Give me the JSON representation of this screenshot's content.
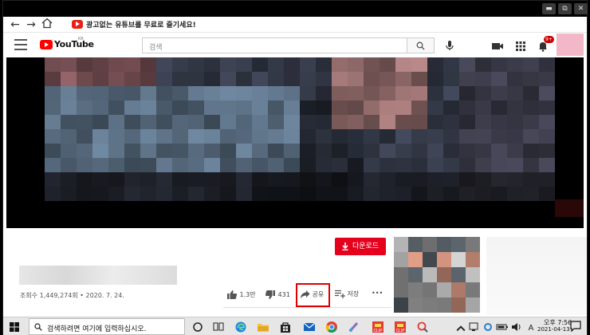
{
  "window": {
    "min": "▬",
    "restore": "⧉",
    "close": "✕"
  },
  "nav": {
    "extension_text": "광고없는 유튜브를 무료로 즐기세요!"
  },
  "header": {
    "logo_text": "YouTube",
    "logo_region": "KR",
    "search_placeholder": "검색",
    "notification_count": "9+"
  },
  "video": {
    "download_label": "다운로드",
    "views_text": "조회수 1,449,274회 • 2020. 7. 24.",
    "like_count": "1.3만",
    "dislike_count": "431",
    "share_label": "공유",
    "save_label": "저장",
    "more_label": "•••"
  },
  "taskbar": {
    "search_text": "검색하려면 여기에 입력하십시오.",
    "time": "오후 7:56",
    "date": "2021-04-13"
  },
  "colors": {
    "yt_red": "#ff0000",
    "download_red": "#e5001d",
    "highlight_red": "#e00000",
    "avatar_pink": "#f2b8c8"
  },
  "icons": [
    "back-icon",
    "forward-icon",
    "home-icon",
    "menu-icon",
    "search-icon",
    "mic-icon",
    "camera-icon",
    "apps-icon",
    "bell-icon",
    "download-icon",
    "like-icon",
    "dislike-icon",
    "share-icon",
    "save-icon",
    "windows-icon",
    "taskview-icon",
    "edge-icon",
    "explorer-icon",
    "store-icon",
    "mail-icon",
    "chrome-icon"
  ]
}
